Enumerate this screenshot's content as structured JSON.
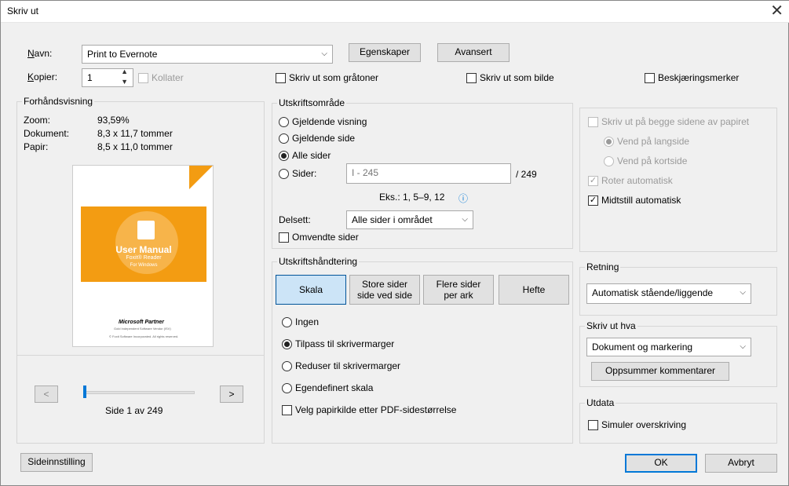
{
  "title": "Skriv ut",
  "printer": {
    "name_label": "Navn:",
    "name_value": "Print to Evernote",
    "properties_label": "Egenskaper",
    "advanced_label": "Avansert"
  },
  "copies": {
    "label": "Kopier:",
    "value": "1",
    "collate_label": "Kollater"
  },
  "options": {
    "grayscale_label": "Skriv ut som gråtoner",
    "as_image_label": "Skriv ut som bilde",
    "crop_marks_label": "Beskjæringsmerker"
  },
  "preview": {
    "title": "Forhåndsvisning",
    "zoom_label": "Zoom:",
    "zoom_value": "93,59%",
    "document_label": "Dokument:",
    "document_value": "8,3 x 11,7 tommer",
    "paper_label": "Papir:",
    "paper_value": "8,5 x 11,0 tommer",
    "page_text": "Side 1 av 249",
    "prev_label": "<",
    "next_label": ">",
    "thumb": {
      "title": "User Manual",
      "subtitle": "Foxit® Reader",
      "subtitle2": "For Windows",
      "partner": "Microsoft Partner",
      "partner_sub": "Gold Independent Software Vendor (ISV)",
      "footer": "© Foxit Software Incorporated. All rights reserved."
    }
  },
  "range": {
    "title": "Utskriftsområde",
    "current_view": "Gjeldende visning",
    "current_page": "Gjeldende side",
    "all_pages": "Alle sider",
    "pages_label": "Sider:",
    "pages_placeholder": "I - 245",
    "pages_total": "/ 249",
    "example": "Eks.: 1, 5–9, 12",
    "subset_label": "Delsett:",
    "subset_value": "Alle sider i området",
    "reverse_label": "Omvendte sider"
  },
  "handling": {
    "title": "Utskriftshåndtering",
    "tabs": [
      "Skala",
      "Store sider side ved side",
      "Flere sider per ark",
      "Hefte"
    ],
    "tab_lines": [
      [
        "Skala"
      ],
      [
        "Store sider",
        "side ved side"
      ],
      [
        "Flere sider",
        "per ark"
      ],
      [
        "Hefte"
      ]
    ],
    "none": "Ingen",
    "fit": "Tilpass til skrivermarger",
    "reduce": "Reduser til skrivermarger",
    "custom": "Egendefinert skala",
    "paper_source": "Velg papirkilde etter PDF-sidestørrelse"
  },
  "duplex": {
    "both_sides": "Skriv ut på begge sidene av papiret",
    "long_edge": "Vend på langside",
    "short_edge": "Vend på kortside",
    "auto_rotate": "Roter automatisk",
    "auto_center": "Midtstill automatisk"
  },
  "orientation": {
    "title": "Retning",
    "value": "Automatisk stående/liggende"
  },
  "what": {
    "title": "Skriv ut hva",
    "value": "Dokument og markering",
    "summarize_label": "Oppsummer kommentarer"
  },
  "output": {
    "title": "Utdata",
    "simulate_label": "Simuler overskriving"
  },
  "footer": {
    "page_setup_label": "Sideinnstilling",
    "ok_label": "OK",
    "cancel_label": "Avbryt"
  },
  "colors": {
    "accent": "#0078d7",
    "thumb_orange": "#f39c12",
    "active_tab": "#cce4f7"
  }
}
